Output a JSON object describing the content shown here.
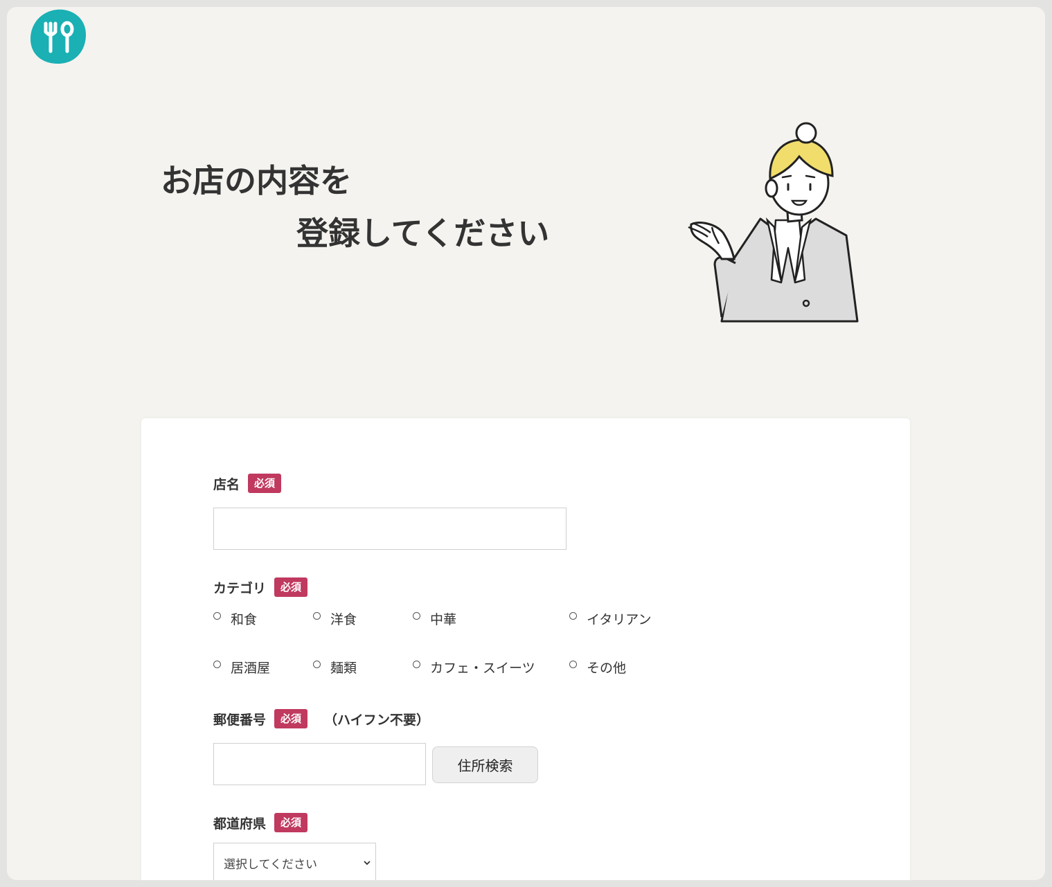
{
  "header": {
    "title_line1": "お店の内容を",
    "title_line2": "登録してください"
  },
  "form": {
    "shop_name": {
      "label": "店名",
      "required": "必須",
      "value": ""
    },
    "category": {
      "label": "カテゴリ",
      "required": "必須",
      "options": [
        "和食",
        "洋食",
        "中華",
        "イタリアン",
        "居酒屋",
        "麺類",
        "カフェ・スイーツ",
        "その他"
      ]
    },
    "postal_code": {
      "label": "郵便番号",
      "required": "必須",
      "note": "（ハイフン不要）",
      "value": "",
      "search_button": "住所検索"
    },
    "prefecture": {
      "label": "都道府県",
      "required": "必須",
      "selected": "選択してください"
    }
  },
  "colors": {
    "page_bg": "#f4f3ef",
    "logo_teal": "#1ab0b4",
    "required_badge": "#c0395f",
    "hair_yellow": "#f1dd6c",
    "suit_gray": "#dcdcdc"
  },
  "icons": {
    "logo": "fork-spoon-icon",
    "select": "chevron-down-icon"
  }
}
